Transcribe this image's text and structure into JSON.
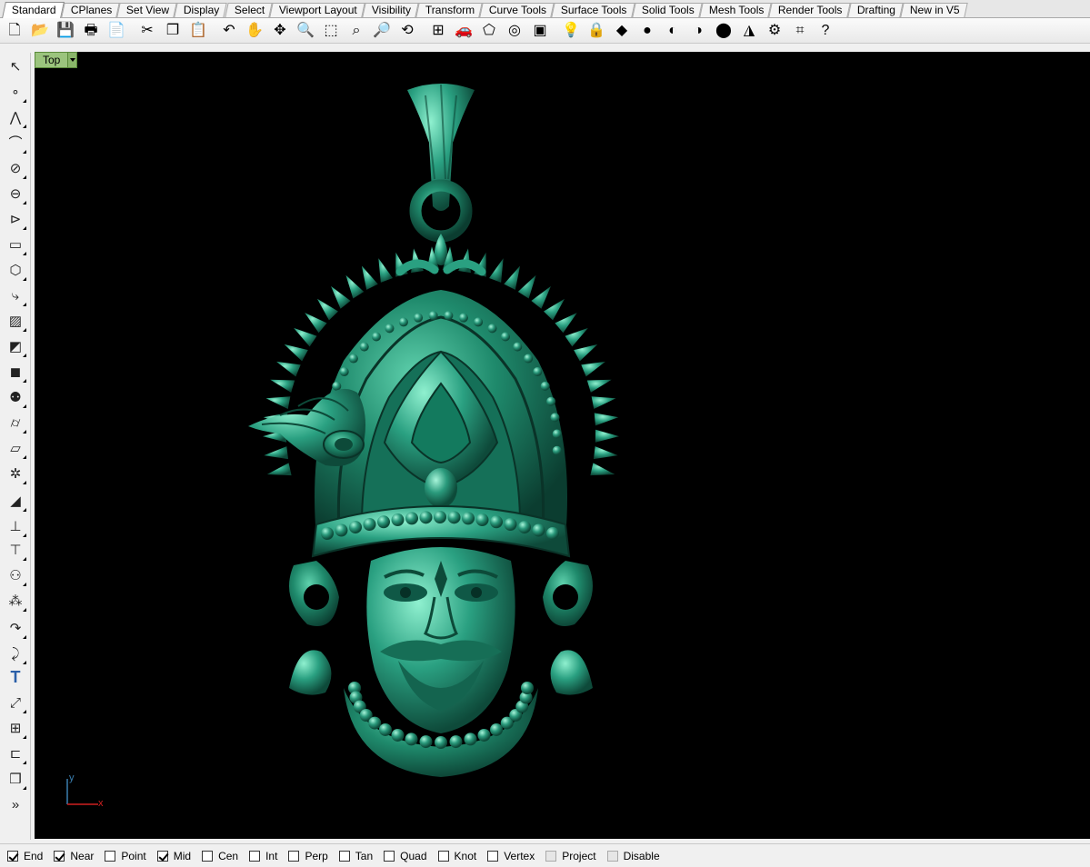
{
  "tabs": [
    "Standard",
    "CPlanes",
    "Set View",
    "Display",
    "Select",
    "Viewport Layout",
    "Visibility",
    "Transform",
    "Curve Tools",
    "Surface Tools",
    "Solid Tools",
    "Mesh Tools",
    "Render Tools",
    "Drafting",
    "New in V5"
  ],
  "active_tab": "Standard",
  "toolbar": [
    {
      "name": "new-file-icon",
      "glyph": "🗋"
    },
    {
      "name": "open-file-icon",
      "glyph": "📂"
    },
    {
      "name": "save-icon",
      "glyph": "💾"
    },
    {
      "name": "print-icon",
      "glyph": "🖶"
    },
    {
      "name": "properties-page-icon",
      "glyph": "📄"
    },
    {
      "name": "cut-icon",
      "glyph": "✂"
    },
    {
      "name": "copy-icon",
      "glyph": "❐"
    },
    {
      "name": "paste-icon",
      "glyph": "📋"
    },
    {
      "name": "undo-icon",
      "glyph": "↶"
    },
    {
      "name": "pan-hand-icon",
      "glyph": "✋"
    },
    {
      "name": "rotate-view-icon",
      "glyph": "✥"
    },
    {
      "name": "zoom-dynamic-icon",
      "glyph": "🔍"
    },
    {
      "name": "zoom-window-icon",
      "glyph": "⬚"
    },
    {
      "name": "zoom-extents-icon",
      "glyph": "⌕"
    },
    {
      "name": "zoom-selected-icon",
      "glyph": "🔎"
    },
    {
      "name": "undo-view-icon",
      "glyph": "⟲"
    },
    {
      "name": "four-viewports-icon",
      "glyph": "⊞"
    },
    {
      "name": "named-view-car-icon",
      "glyph": "🚗"
    },
    {
      "name": "cplane-icon",
      "glyph": "⬠"
    },
    {
      "name": "osnap-icon",
      "glyph": "◎"
    },
    {
      "name": "select-filter-icon",
      "glyph": "▣"
    },
    {
      "name": "lights-icon",
      "glyph": "💡"
    },
    {
      "name": "lock-icon",
      "glyph": "🔒"
    },
    {
      "name": "layers-icon",
      "glyph": "◆"
    },
    {
      "name": "color-wheel-icon",
      "glyph": "●"
    },
    {
      "name": "shaded-sphere-icon",
      "glyph": "◐"
    },
    {
      "name": "rendered-sphere-icon",
      "glyph": "◑"
    },
    {
      "name": "render-icon",
      "glyph": "⬤"
    },
    {
      "name": "analyze-icon",
      "glyph": "◮"
    },
    {
      "name": "options-gear-icon",
      "glyph": "⚙"
    },
    {
      "name": "dimension-icon",
      "glyph": "⌗"
    },
    {
      "name": "help-icon",
      "glyph": "?"
    }
  ],
  "left_toolbar": [
    {
      "name": "select-arrow-icon",
      "glyph": "↖",
      "flyout": false
    },
    {
      "name": "point-icon",
      "glyph": "∘",
      "flyout": true
    },
    {
      "name": "polyline-icon",
      "glyph": "⋀",
      "flyout": true
    },
    {
      "name": "curve-cv-icon",
      "glyph": "⌒",
      "flyout": true
    },
    {
      "name": "circle-icon",
      "glyph": "⊘",
      "flyout": true
    },
    {
      "name": "ellipse-icon",
      "glyph": "⊖",
      "flyout": true
    },
    {
      "name": "arc-icon",
      "glyph": "⊳",
      "flyout": true
    },
    {
      "name": "rectangle-icon",
      "glyph": "▭",
      "flyout": true
    },
    {
      "name": "polygon-icon",
      "glyph": "⬡",
      "flyout": true
    },
    {
      "name": "curve-fillet-icon",
      "glyph": "⤷",
      "flyout": true
    },
    {
      "name": "surface-corners-icon",
      "glyph": "▨",
      "flyout": true
    },
    {
      "name": "extrude-surface-icon",
      "glyph": "◩",
      "flyout": true
    },
    {
      "name": "box-solid-icon",
      "glyph": "◼",
      "flyout": true
    },
    {
      "name": "boolean-union-icon",
      "glyph": "⚉",
      "flyout": true
    },
    {
      "name": "cylinder-icon",
      "glyph": "⌭",
      "flyout": true
    },
    {
      "name": "mesh-plane-icon",
      "glyph": "▱",
      "flyout": true
    },
    {
      "name": "render-gear-icon",
      "glyph": "✲",
      "flyout": true
    },
    {
      "name": "split-icon",
      "glyph": "◢",
      "flyout": true
    },
    {
      "name": "trim-icon",
      "glyph": "⊥",
      "flyout": true
    },
    {
      "name": "join-icon",
      "glyph": "⊤",
      "flyout": true
    },
    {
      "name": "explode-icon",
      "glyph": "⚇",
      "flyout": true
    },
    {
      "name": "group-icon",
      "glyph": "⁂",
      "flyout": true
    },
    {
      "name": "fillet-edge-icon",
      "glyph": "↷",
      "flyout": true
    },
    {
      "name": "offset-curve-icon",
      "glyph": "⤸",
      "flyout": true
    },
    {
      "name": "text-icon",
      "glyph": "T",
      "flyout": false
    },
    {
      "name": "scale-icon",
      "glyph": "⤢",
      "flyout": true
    },
    {
      "name": "array-icon",
      "glyph": "⊞",
      "flyout": true
    },
    {
      "name": "dimension-icon",
      "glyph": "⊏",
      "flyout": true
    },
    {
      "name": "solid-box-3d-icon",
      "glyph": "❒",
      "flyout": true
    },
    {
      "name": "more-icon",
      "glyph": "»",
      "flyout": false
    }
  ],
  "viewport": {
    "label": "Top",
    "background": "#000000",
    "model_color": "#1f8a6c",
    "axis_x_label": "x",
    "axis_y_label": "y"
  },
  "osnaps": [
    {
      "label": "End",
      "checked": true,
      "disabled": false
    },
    {
      "label": "Near",
      "checked": true,
      "disabled": false
    },
    {
      "label": "Point",
      "checked": false,
      "disabled": false
    },
    {
      "label": "Mid",
      "checked": true,
      "disabled": false
    },
    {
      "label": "Cen",
      "checked": false,
      "disabled": false
    },
    {
      "label": "Int",
      "checked": false,
      "disabled": false
    },
    {
      "label": "Perp",
      "checked": false,
      "disabled": false
    },
    {
      "label": "Tan",
      "checked": false,
      "disabled": false
    },
    {
      "label": "Quad",
      "checked": false,
      "disabled": false
    },
    {
      "label": "Knot",
      "checked": false,
      "disabled": false
    },
    {
      "label": "Vertex",
      "checked": false,
      "disabled": false
    },
    {
      "label": "Project",
      "checked": false,
      "disabled": true
    },
    {
      "label": "Disable",
      "checked": false,
      "disabled": true
    }
  ]
}
